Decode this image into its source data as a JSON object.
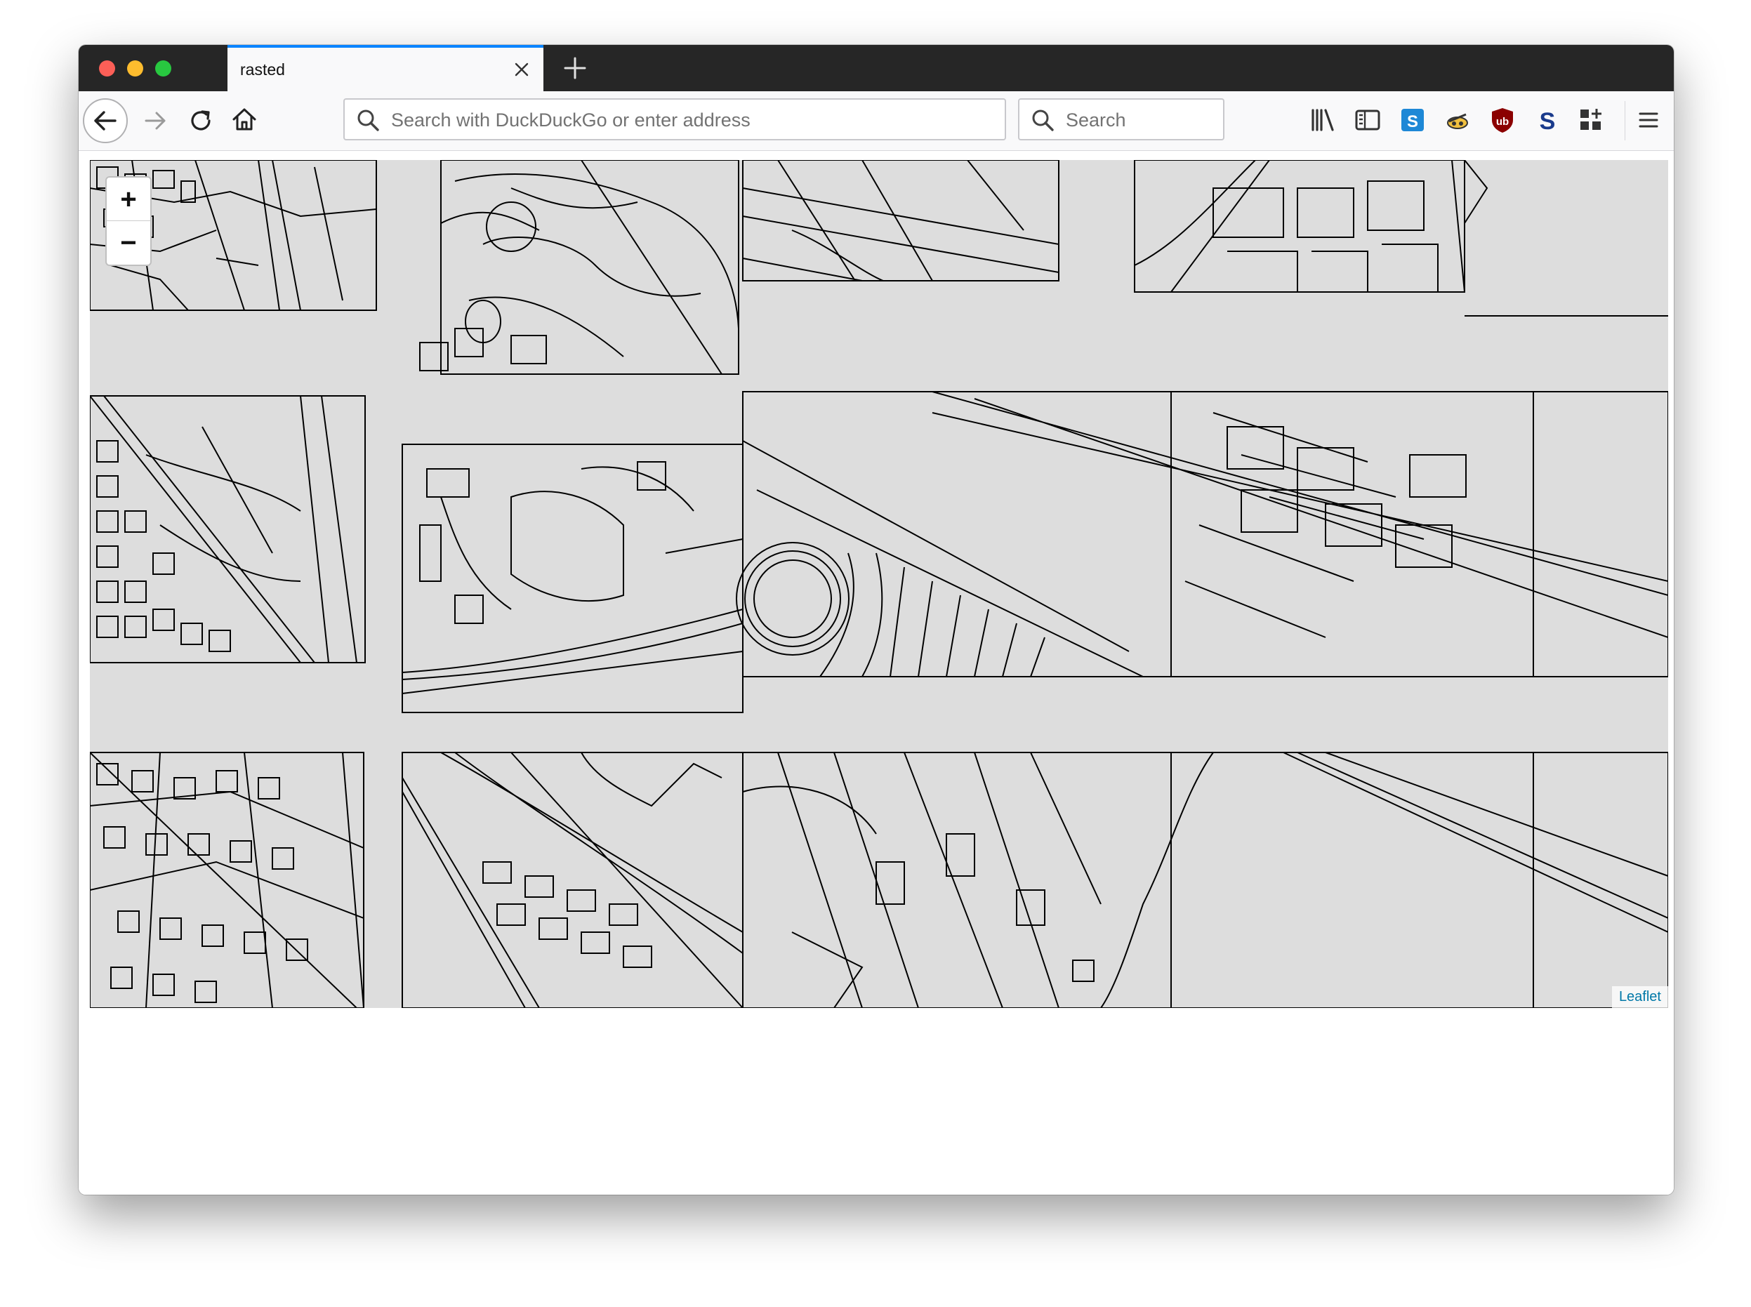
{
  "tab": {
    "title": "rasted"
  },
  "toolbar": {
    "url_placeholder": "Search with DuckDuckGo or enter address",
    "search_placeholder": "Search",
    "icons": [
      "back-arrow-icon",
      "forward-arrow-icon",
      "reload-icon",
      "home-icon",
      "library-icon",
      "sidebar-icon",
      "extension-s-blue-icon",
      "extension-spy-icon",
      "ublock-origin-icon",
      "extension-s-dark-icon",
      "extension-grid-icon",
      "hamburger-menu-icon"
    ]
  },
  "map": {
    "zoom_in_label": "+",
    "zoom_out_label": "−",
    "attribution_label": "Leaflet",
    "background_color": "#dddddd",
    "line_color": "#000000"
  },
  "colors": {
    "tab_accent": "#0a84ff",
    "tabbar_bg": "#262626",
    "toolbar_bg": "#f9f9fa",
    "close_light": "#fc5f57",
    "minimize_light": "#fdbc2e",
    "maximize_light": "#28c840",
    "ublock_red": "#8b0000",
    "extension_blue": "#1e88d6",
    "attribution_link": "#0078a8"
  }
}
